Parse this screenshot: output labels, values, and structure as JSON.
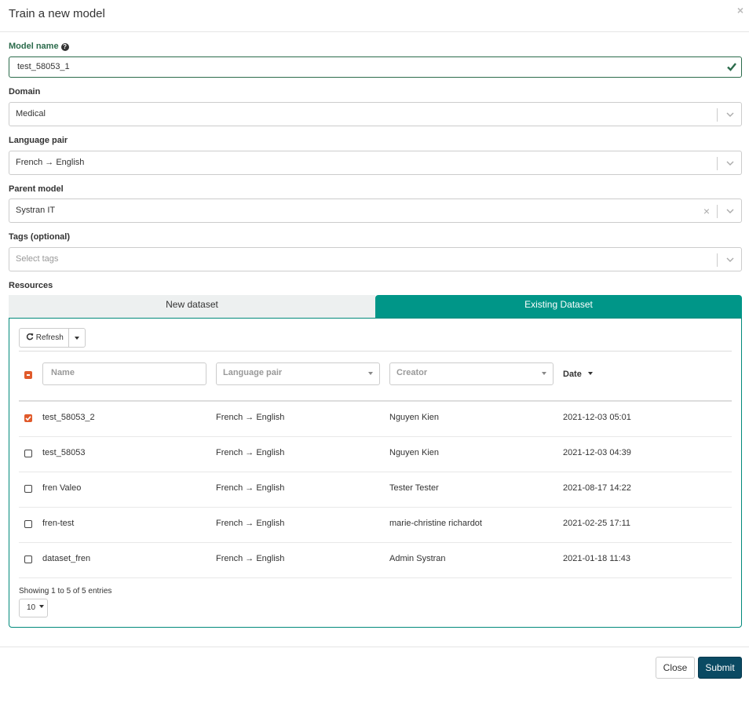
{
  "modal": {
    "title": "Train a new model",
    "close_glyph": "×"
  },
  "form": {
    "model_name": {
      "label": "Model name",
      "help_glyph": "?",
      "value": "test_58053_1"
    },
    "domain": {
      "label": "Domain",
      "value": "Medical"
    },
    "language_pair": {
      "label": "Language pair",
      "value": "French → English"
    },
    "parent_model": {
      "label": "Parent model",
      "value": "Systran IT",
      "clear_glyph": "×"
    },
    "tags": {
      "label": "Tags (optional)",
      "placeholder": "Select tags"
    },
    "resources": {
      "label": "Resources"
    }
  },
  "tabs": [
    {
      "label": "New dataset",
      "active": false
    },
    {
      "label": "Existing Dataset",
      "active": true
    }
  ],
  "toolbar": {
    "refresh_label": "Refresh"
  },
  "filters": {
    "name_placeholder": "Name",
    "language_pair_placeholder": "Language pair",
    "creator_placeholder": "Creator",
    "date_label": "Date"
  },
  "rows": [
    {
      "name": "test_58053_2",
      "language_pair": "French → English",
      "creator": "Nguyen Kien",
      "date": "2021-12-03 05:01",
      "checked": true
    },
    {
      "name": "test_58053",
      "language_pair": "French → English",
      "creator": "Nguyen Kien",
      "date": "2021-12-03 04:39",
      "checked": false
    },
    {
      "name": "fren Valeo",
      "language_pair": "French → English",
      "creator": "Tester Tester",
      "date": "2021-08-17 14:22",
      "checked": false
    },
    {
      "name": "fren-test",
      "language_pair": "French → English",
      "creator": "marie-christine richardot",
      "date": "2021-02-25 17:11",
      "checked": false
    },
    {
      "name": "dataset_fren",
      "language_pair": "French → English",
      "creator": "Admin Systran",
      "date": "2021-01-18 11:43",
      "checked": false
    }
  ],
  "pagination": {
    "showing_text": "Showing 1 to 5 of 5 entries",
    "page_size": "10"
  },
  "footer": {
    "close_label": "Close",
    "submit_label": "Submit"
  },
  "colors": {
    "accent_teal": "#009688",
    "valid_green": "#2b6b4b",
    "checkbox_orange": "#e05a2b",
    "submit_navy": "#0a4a63"
  }
}
